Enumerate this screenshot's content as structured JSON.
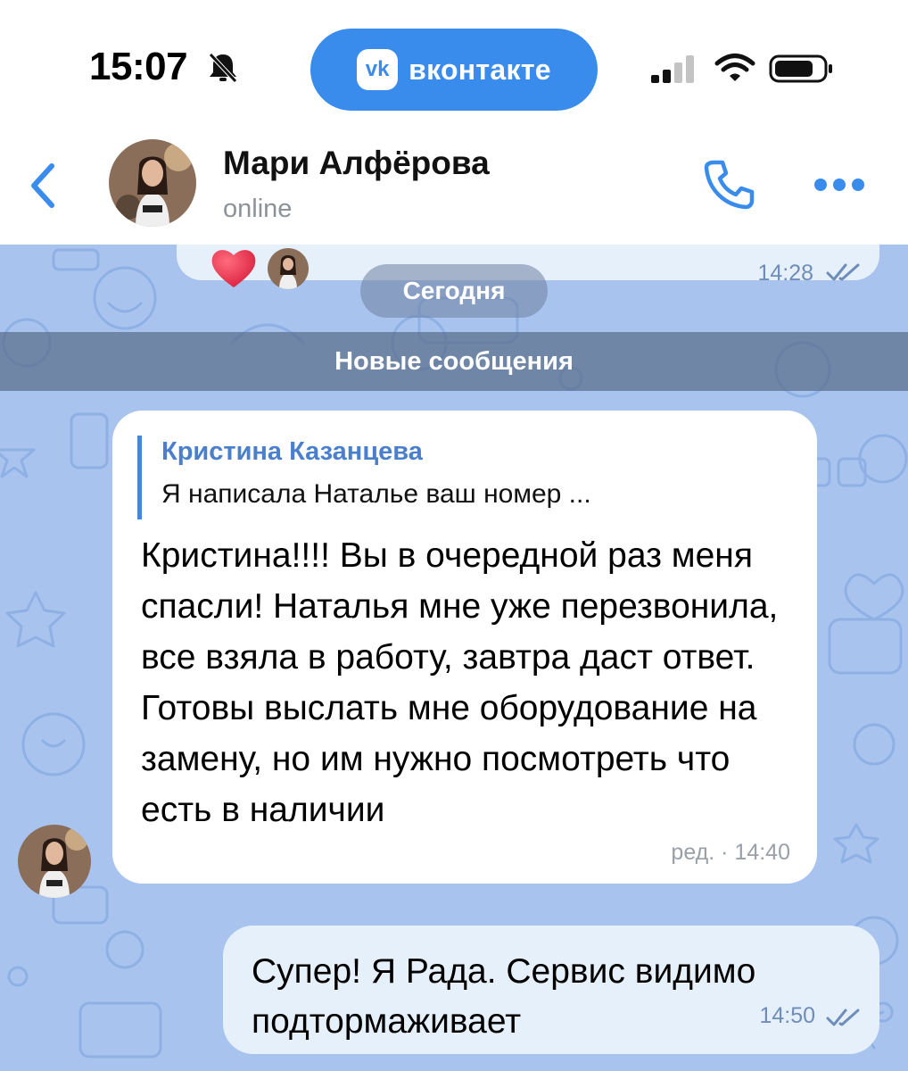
{
  "status_bar": {
    "time": "15:07",
    "app_pill_label": "вконтакте",
    "app_logo_text": "vk"
  },
  "chat_header": {
    "contact_name": "Мари Алфёрова",
    "contact_status": "online"
  },
  "messages": {
    "previous_time": "14:28",
    "date_divider": "Сегодня",
    "new_messages_label": "Новые сообщения",
    "incoming": {
      "reply_author": "Кристина Казанцева",
      "reply_text": "Я написала Наталье ваш номер ...",
      "text": "Кристина!!!! Вы в очередной раз меня спасли! Наталья мне уже перезвонила, все взяла в работу, завтра даст ответ. Готовы выслать мне оборудование на замену, но им нужно посмотреть что есть в наличии",
      "meta": "ред. · 14:40"
    },
    "outgoing": {
      "text": "Супер! Я Рада. Сервис видимо подтормаживает",
      "time": "14:50"
    }
  },
  "colors": {
    "accent": "#3a8cec",
    "chat_background": "#a8c4ee",
    "outgoing_bubble": "#e6f0fb",
    "incoming_bubble": "#ffffff",
    "reply_author": "#4a7fcc"
  },
  "icons": [
    "bell-muted-icon",
    "signal-icon",
    "wifi-icon",
    "battery-icon",
    "back-chevron-icon",
    "phone-icon",
    "more-dots-icon",
    "heart-icon",
    "read-ticks-icon"
  ]
}
